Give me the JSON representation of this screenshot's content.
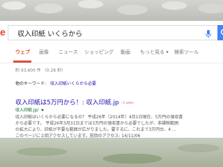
{
  "search": {
    "logo_fragment": "e",
    "query": "収入印紙 いくらから"
  },
  "tabs": [
    {
      "label": "ウェブ"
    },
    {
      "label": "画像"
    },
    {
      "label": "ニュース"
    },
    {
      "label": "ショッピング"
    },
    {
      "label": "動画"
    },
    {
      "label": "もっと見る ▾"
    },
    {
      "label": "検索ツール"
    }
  ],
  "result_stats": "約 93,600 件 （0.28 秒）",
  "other_keywords": {
    "label": "他のキーワード:",
    "link": "収入印紙いくらから必要"
  },
  "result": {
    "title": "収入印紙は5万円から！: 収入印紙.jp",
    "badge": "ⓑ users",
    "url": "収入印紙.jp/",
    "snippet": [
      "収入印紙はいくらから必要になるの？ 平成26年（2014年）4月1日現在、5万円の領収書",
      "から必要です。 平成26年3月31日までは3万円の領収書から必要でしたが、非課税範囲",
      "の拡大により、印紙が不要な範囲が広がりました。要するに、これまで3万円台、4 ...",
      "このページに２回アクセスしています。前回のアクセス: 14/11/06"
    ]
  },
  "colors": {
    "accent_red": "#dd4b39",
    "link_blue": "#1a0dab",
    "url_green": "#006621",
    "search_button_blue": "#4285f4"
  },
  "icons": {
    "mic": "microphone-icon",
    "search": "search-icon"
  }
}
